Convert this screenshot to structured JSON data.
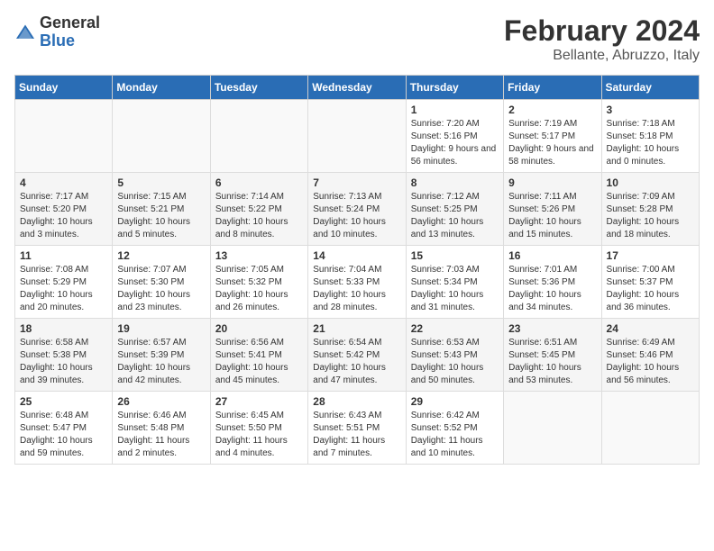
{
  "header": {
    "logo_general": "General",
    "logo_blue": "Blue",
    "month": "February 2024",
    "location": "Bellante, Abruzzo, Italy"
  },
  "weekdays": [
    "Sunday",
    "Monday",
    "Tuesday",
    "Wednesday",
    "Thursday",
    "Friday",
    "Saturday"
  ],
  "weeks": [
    [
      {
        "day": "",
        "info": ""
      },
      {
        "day": "",
        "info": ""
      },
      {
        "day": "",
        "info": ""
      },
      {
        "day": "",
        "info": ""
      },
      {
        "day": "1",
        "info": "Sunrise: 7:20 AM\nSunset: 5:16 PM\nDaylight: 9 hours\nand 56 minutes."
      },
      {
        "day": "2",
        "info": "Sunrise: 7:19 AM\nSunset: 5:17 PM\nDaylight: 9 hours\nand 58 minutes."
      },
      {
        "day": "3",
        "info": "Sunrise: 7:18 AM\nSunset: 5:18 PM\nDaylight: 10 hours\nand 0 minutes."
      }
    ],
    [
      {
        "day": "4",
        "info": "Sunrise: 7:17 AM\nSunset: 5:20 PM\nDaylight: 10 hours\nand 3 minutes."
      },
      {
        "day": "5",
        "info": "Sunrise: 7:15 AM\nSunset: 5:21 PM\nDaylight: 10 hours\nand 5 minutes."
      },
      {
        "day": "6",
        "info": "Sunrise: 7:14 AM\nSunset: 5:22 PM\nDaylight: 10 hours\nand 8 minutes."
      },
      {
        "day": "7",
        "info": "Sunrise: 7:13 AM\nSunset: 5:24 PM\nDaylight: 10 hours\nand 10 minutes."
      },
      {
        "day": "8",
        "info": "Sunrise: 7:12 AM\nSunset: 5:25 PM\nDaylight: 10 hours\nand 13 minutes."
      },
      {
        "day": "9",
        "info": "Sunrise: 7:11 AM\nSunset: 5:26 PM\nDaylight: 10 hours\nand 15 minutes."
      },
      {
        "day": "10",
        "info": "Sunrise: 7:09 AM\nSunset: 5:28 PM\nDaylight: 10 hours\nand 18 minutes."
      }
    ],
    [
      {
        "day": "11",
        "info": "Sunrise: 7:08 AM\nSunset: 5:29 PM\nDaylight: 10 hours\nand 20 minutes."
      },
      {
        "day": "12",
        "info": "Sunrise: 7:07 AM\nSunset: 5:30 PM\nDaylight: 10 hours\nand 23 minutes."
      },
      {
        "day": "13",
        "info": "Sunrise: 7:05 AM\nSunset: 5:32 PM\nDaylight: 10 hours\nand 26 minutes."
      },
      {
        "day": "14",
        "info": "Sunrise: 7:04 AM\nSunset: 5:33 PM\nDaylight: 10 hours\nand 28 minutes."
      },
      {
        "day": "15",
        "info": "Sunrise: 7:03 AM\nSunset: 5:34 PM\nDaylight: 10 hours\nand 31 minutes."
      },
      {
        "day": "16",
        "info": "Sunrise: 7:01 AM\nSunset: 5:36 PM\nDaylight: 10 hours\nand 34 minutes."
      },
      {
        "day": "17",
        "info": "Sunrise: 7:00 AM\nSunset: 5:37 PM\nDaylight: 10 hours\nand 36 minutes."
      }
    ],
    [
      {
        "day": "18",
        "info": "Sunrise: 6:58 AM\nSunset: 5:38 PM\nDaylight: 10 hours\nand 39 minutes."
      },
      {
        "day": "19",
        "info": "Sunrise: 6:57 AM\nSunset: 5:39 PM\nDaylight: 10 hours\nand 42 minutes."
      },
      {
        "day": "20",
        "info": "Sunrise: 6:56 AM\nSunset: 5:41 PM\nDaylight: 10 hours\nand 45 minutes."
      },
      {
        "day": "21",
        "info": "Sunrise: 6:54 AM\nSunset: 5:42 PM\nDaylight: 10 hours\nand 47 minutes."
      },
      {
        "day": "22",
        "info": "Sunrise: 6:53 AM\nSunset: 5:43 PM\nDaylight: 10 hours\nand 50 minutes."
      },
      {
        "day": "23",
        "info": "Sunrise: 6:51 AM\nSunset: 5:45 PM\nDaylight: 10 hours\nand 53 minutes."
      },
      {
        "day": "24",
        "info": "Sunrise: 6:49 AM\nSunset: 5:46 PM\nDaylight: 10 hours\nand 56 minutes."
      }
    ],
    [
      {
        "day": "25",
        "info": "Sunrise: 6:48 AM\nSunset: 5:47 PM\nDaylight: 10 hours\nand 59 minutes."
      },
      {
        "day": "26",
        "info": "Sunrise: 6:46 AM\nSunset: 5:48 PM\nDaylight: 11 hours\nand 2 minutes."
      },
      {
        "day": "27",
        "info": "Sunrise: 6:45 AM\nSunset: 5:50 PM\nDaylight: 11 hours\nand 4 minutes."
      },
      {
        "day": "28",
        "info": "Sunrise: 6:43 AM\nSunset: 5:51 PM\nDaylight: 11 hours\nand 7 minutes."
      },
      {
        "day": "29",
        "info": "Sunrise: 6:42 AM\nSunset: 5:52 PM\nDaylight: 11 hours\nand 10 minutes."
      },
      {
        "day": "",
        "info": ""
      },
      {
        "day": "",
        "info": ""
      }
    ]
  ]
}
